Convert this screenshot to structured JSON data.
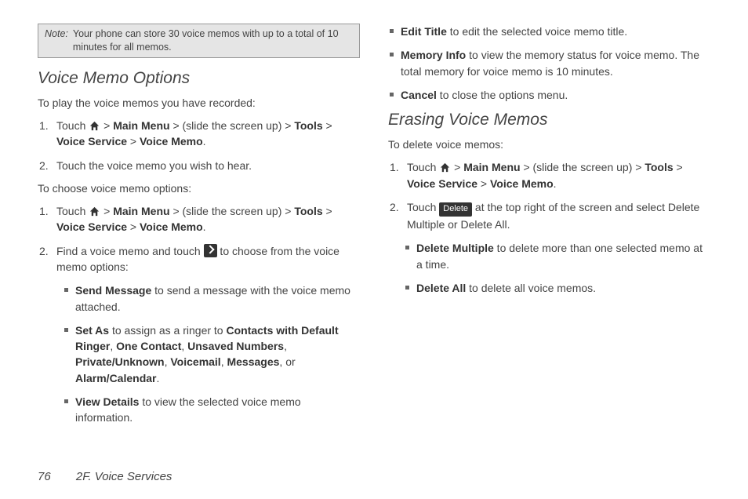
{
  "note": {
    "label": "Note:",
    "text": "Your phone can store 30 voice memos with up to a total of 10 minutes for all memos."
  },
  "col1": {
    "h_options": "Voice Memo Options",
    "intro_play": "To play the voice memos you have recorded:",
    "play1_a": "Touch ",
    "play1_b": " > ",
    "play1_main": "Main Menu",
    "play1_c": " > (slide the screen up) > ",
    "play1_tools": "Tools",
    "play1_d": " > ",
    "play1_vs": "Voice Service",
    "play1_e": " > ",
    "play1_vm": "Voice Memo",
    "play1_f": ".",
    "play2": "Touch the voice memo you wish to hear.",
    "intro_choose": "To choose voice memo options:",
    "opt2_a": "Find a voice memo and touch ",
    "opt2_b": " to choose from the voice memo options:",
    "sub_send_b": "Send Message",
    "sub_send_t": " to send a message with the voice memo attached.",
    "sub_setas_b": "Set As",
    "sub_setas_t1": " to assign as a ringer to ",
    "sub_setas_c1": "Contacts with Default Ringer",
    "sub_setas_s1": ", ",
    "sub_setas_c2": "One Contact",
    "sub_setas_s2": ", ",
    "sub_setas_c3": "Unsaved Numbers",
    "sub_setas_s3": ", ",
    "sub_setas_c4": "Private/Unknown",
    "sub_setas_s4": ", ",
    "sub_setas_c5": "Voicemail",
    "sub_setas_s5": ", ",
    "sub_setas_c6": "Messages",
    "sub_setas_s6": ", or ",
    "sub_setas_c7": "Alarm/Calendar",
    "sub_setas_s7": ".",
    "sub_view_b": "View Details",
    "sub_view_t": " to view the selected voice memo information."
  },
  "col2": {
    "sub_edit_b": "Edit Title",
    "sub_edit_t": " to edit the selected voice memo title.",
    "sub_mem_b": "Memory Info",
    "sub_mem_t": " to view the memory status for voice memo. The total memory for voice memo is 10 minutes.",
    "sub_cancel_b": "Cancel",
    "sub_cancel_t": " to close the options menu.",
    "h_erase": "Erasing Voice Memos",
    "intro_erase": "To delete voice memos:",
    "er2_a": "Touch ",
    "er2_del": "Delete",
    "er2_b": " at the top right of the screen and select Delete Multiple or Delete All.",
    "sub_delm_b": "Delete Multiple",
    "sub_delm_t": " to delete more than one selected memo at a time.",
    "sub_dela_b": "Delete All",
    "sub_dela_t": " to delete all voice memos."
  },
  "footer": {
    "page": "76",
    "section": "2F. Voice Services"
  }
}
